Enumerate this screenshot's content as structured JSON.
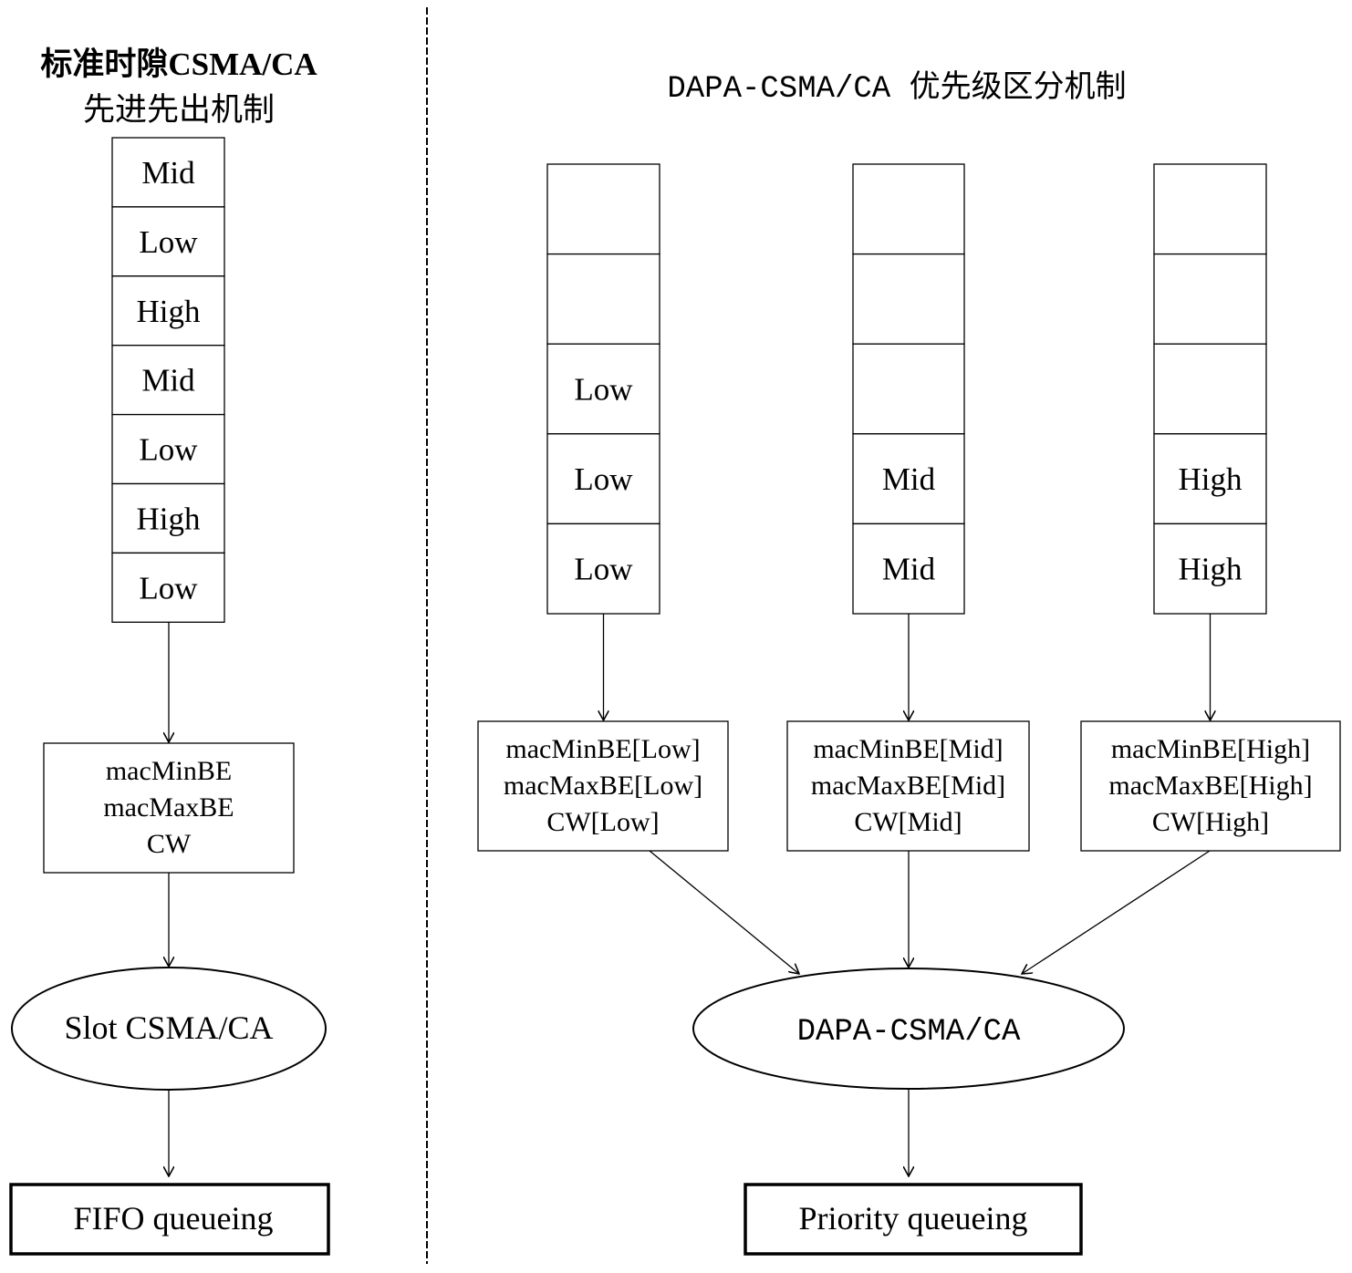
{
  "left_panel": {
    "title_line1": "标准时隙CSMA/CA",
    "title_line2": "先进先出机制",
    "queue": [
      "Mid",
      "Low",
      "High",
      "Mid",
      "Low",
      "High",
      "Low"
    ],
    "params": [
      "macMinBE",
      "macMaxBE",
      "CW"
    ],
    "process": "Slot CSMA/CA",
    "output": "FIFO queueing"
  },
  "right_panel": {
    "title": "DAPA-CSMA/CA 优先级区分机制",
    "queues": [
      {
        "priority": "Low",
        "cells": [
          "",
          "",
          "Low",
          "Low",
          "Low"
        ],
        "params": [
          "macMinBE[Low]",
          "macMaxBE[Low]",
          "CW[Low]"
        ]
      },
      {
        "priority": "Mid",
        "cells": [
          "",
          "",
          "",
          "Mid",
          "Mid"
        ],
        "params": [
          "macMinBE[Mid]",
          "macMaxBE[Mid]",
          "CW[Mid]"
        ]
      },
      {
        "priority": "High",
        "cells": [
          "",
          "",
          "",
          "High",
          "High"
        ],
        "params": [
          "macMinBE[High]",
          "macMaxBE[High]",
          "CW[High]"
        ]
      }
    ],
    "process": "DAPA-CSMA/CA",
    "output": "Priority queueing"
  },
  "colors": {
    "stroke": "#000000",
    "background": "#ffffff"
  }
}
